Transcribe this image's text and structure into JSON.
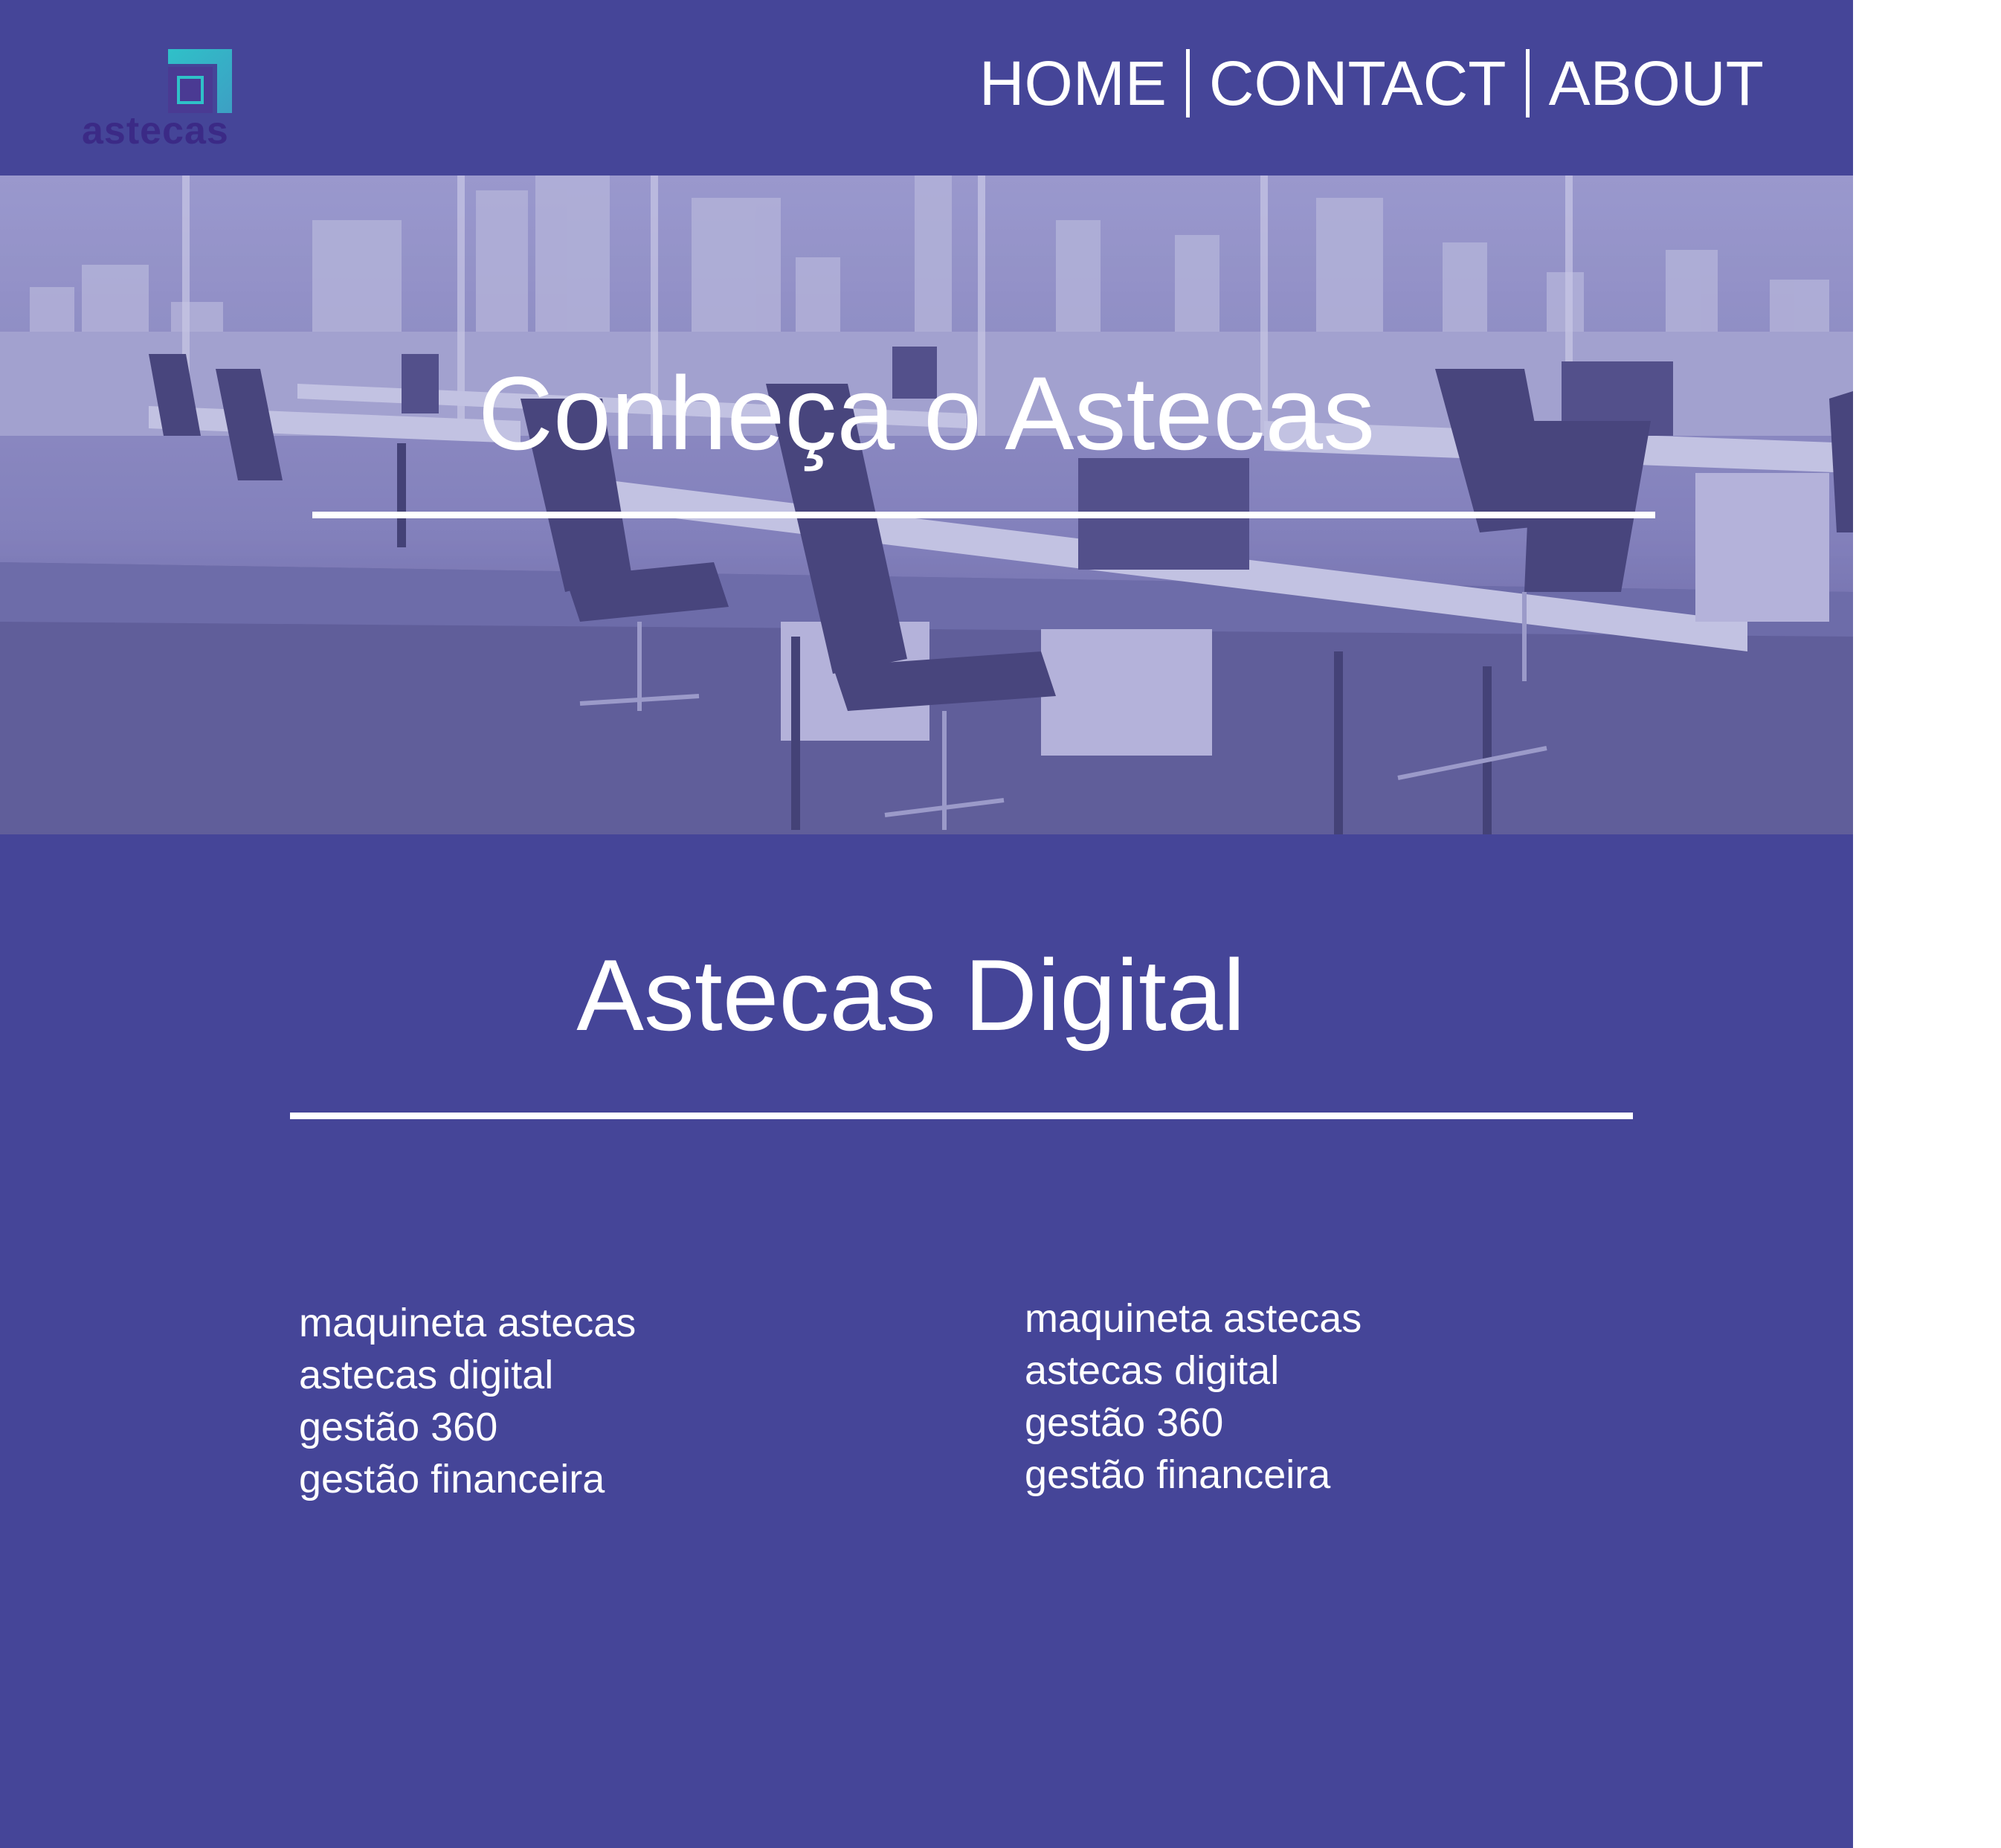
{
  "brand": {
    "name": "astecas",
    "colors": {
      "primary": "#454598",
      "logo_teal": "#2fc1c8",
      "logo_purple": "#3b2a86"
    }
  },
  "nav": {
    "items": [
      {
        "label": "HOME"
      },
      {
        "label": "CONTACT"
      },
      {
        "label": "ABOUT"
      }
    ]
  },
  "hero": {
    "title": "Conheça o Astecas",
    "image": "office-interior-city-view"
  },
  "main": {
    "title": "Astecas Digital",
    "columns": [
      {
        "links": [
          "maquineta astecas",
          "astecas digital",
          "gestão 360",
          "gestão financeira"
        ]
      },
      {
        "links": [
          "maquineta astecas",
          "astecas digital",
          "gestão 360",
          "gestão financeira"
        ]
      }
    ]
  }
}
